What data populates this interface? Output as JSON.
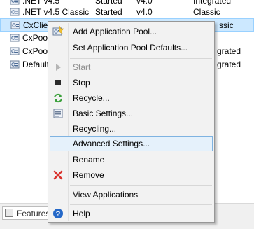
{
  "pools": [
    {
      "name": ".NET v4.5",
      "status": "Started",
      "version": "v4.0",
      "pipeline": "Integrated"
    },
    {
      "name": ".NET v4.5 Classic",
      "status": "Started",
      "version": "v4.0",
      "pipeline": "Classic"
    },
    {
      "name": "CxClien",
      "status": "",
      "version": "",
      "pipeline": "ssic"
    },
    {
      "name": "CxPool",
      "status": "",
      "version": "",
      "pipeline": ""
    },
    {
      "name": "CxPool",
      "status": "",
      "version": "",
      "pipeline": "grated"
    },
    {
      "name": "Default",
      "status": "",
      "version": "",
      "pipeline": "grated"
    }
  ],
  "context_menu": {
    "items": [
      {
        "label": "Add Application Pool...",
        "icon": "add-pool-icon"
      },
      {
        "label": "Set Application Pool Defaults...",
        "icon": ""
      },
      {
        "label": "Start",
        "icon": "play-icon",
        "disabled": true
      },
      {
        "label": "Stop",
        "icon": "stop-icon"
      },
      {
        "label": "Recycle...",
        "icon": "recycle-icon"
      },
      {
        "label": "Basic Settings...",
        "icon": "settings-icon"
      },
      {
        "label": "Recycling...",
        "icon": ""
      },
      {
        "label": "Advanced Settings...",
        "icon": "",
        "highlighted": true
      },
      {
        "label": "Rename",
        "icon": ""
      },
      {
        "label": "Remove",
        "icon": "remove-icon"
      },
      {
        "label": "View Applications",
        "icon": ""
      },
      {
        "label": "Help",
        "icon": "help-icon"
      }
    ]
  },
  "bottom": {
    "features_tab": "Features"
  },
  "colors": {
    "selection": "#cce8ff",
    "menu_highlight": "#e5f1fb",
    "remove_red": "#d9312b",
    "help_blue": "#2468c8",
    "recycle_green": "#3aa03a"
  }
}
